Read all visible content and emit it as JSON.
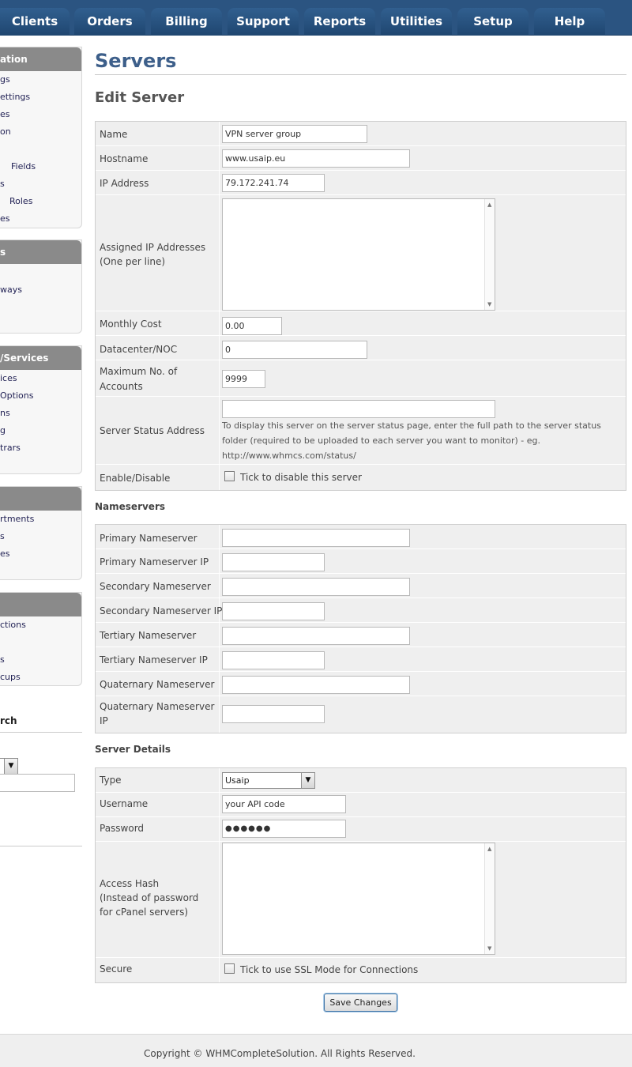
{
  "nav": {
    "tabs": [
      "Clients",
      "Orders",
      "Billing",
      "Support",
      "Reports",
      "Utilities",
      "Setup",
      "Help"
    ]
  },
  "sidebar": {
    "boxes": [
      {
        "title": "ation",
        "items": [
          "gs",
          "ettings",
          "es",
          "on",
          "",
          "Fields",
          "s",
          "Roles",
          "es"
        ]
      },
      {
        "title": "s",
        "items": [
          "",
          "ways",
          ""
        ]
      },
      {
        "title": "/Services",
        "items": [
          "ices",
          "Options",
          "ns",
          "g",
          "trars"
        ]
      },
      {
        "title": "",
        "items": [
          "rtments",
          "s",
          "es"
        ]
      },
      {
        "title": "",
        "items": [
          "ctions",
          "",
          "s",
          "cups"
        ]
      }
    ],
    "search_title": "rch"
  },
  "page": {
    "title": "Servers",
    "subtitle": "Edit Server"
  },
  "server": {
    "name_label": "Name",
    "name_value": "VPN server group",
    "hostname_label": "Hostname",
    "hostname_value": "www.usaip.eu",
    "ip_label": "IP Address",
    "ip_value": "79.172.241.74",
    "assigned_label_1": "Assigned IP Addresses",
    "assigned_label_2": "(One per line)",
    "monthly_cost_label": "Monthly Cost",
    "monthly_cost_value": "0.00",
    "datacenter_label": "Datacenter/NOC",
    "datacenter_value": "0",
    "max_accounts_label_1": "Maximum No. of",
    "max_accounts_label_2": "Accounts",
    "max_accounts_value": "9999",
    "status_address_label": "Server Status Address",
    "status_help_1": "To display this server on the server status page, enter the full path to the server status",
    "status_help_2": "folder (required to be uploaded to each server you want to monitor) - eg.",
    "status_help_3": "http://www.whmcs.com/status/",
    "enable_label": "Enable/Disable",
    "disable_checkbox_label": "Tick to disable this server"
  },
  "nameservers": {
    "section_title": "Nameservers",
    "rows": [
      {
        "label": "Primary Nameserver"
      },
      {
        "label": "Primary Nameserver IP"
      },
      {
        "label": "Secondary Nameserver"
      },
      {
        "label": "Secondary Nameserver IP"
      },
      {
        "label": "Tertiary Nameserver"
      },
      {
        "label": "Tertiary Nameserver IP"
      },
      {
        "label": "Quaternary Nameserver"
      }
    ],
    "last_label_1": "Quaternary Nameserver",
    "last_label_2": "IP"
  },
  "details": {
    "section_title": "Server Details",
    "type_label": "Type",
    "type_value": "Usaip",
    "username_label": "Username",
    "username_value": "your API code",
    "password_label": "Password",
    "password_value": "●●●●●●",
    "hash_label_1": "Access Hash",
    "hash_label_2": "(Instead of password",
    "hash_label_3": "for cPanel servers)",
    "secure_label": "Secure",
    "ssl_checkbox_label": "Tick to use SSL Mode for Connections"
  },
  "actions": {
    "save_label": "Save Changes"
  },
  "footer": {
    "prefix": "Copyright © ",
    "brand": "WHMCompleteSolution",
    "suffix": ". All Rights Reserved."
  }
}
